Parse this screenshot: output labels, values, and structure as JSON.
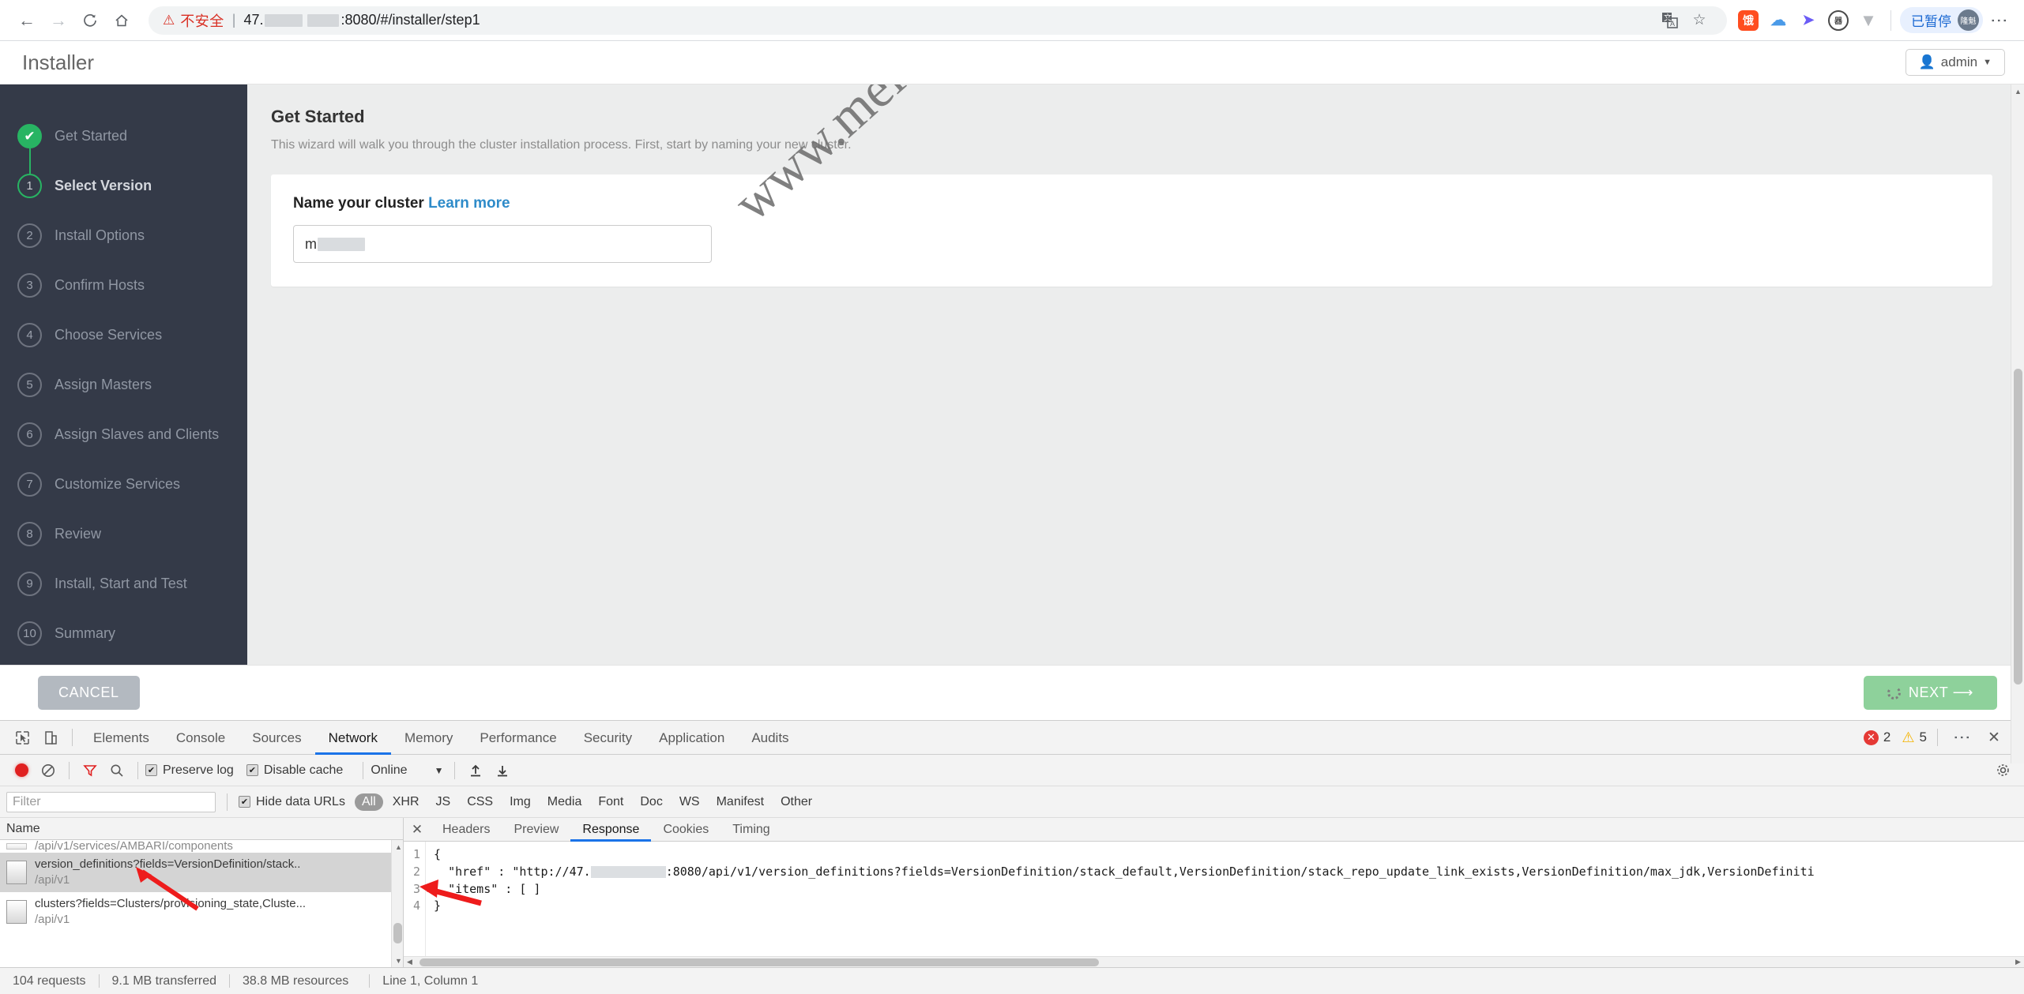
{
  "browser": {
    "nav": {
      "back": "←",
      "forward": "→",
      "reload": "C",
      "home": "⌂"
    },
    "security_warning": "不安全",
    "url_prefix": "47.",
    "url_suffix": ":8080/#/installer/step1",
    "translate_icon": "translate-icon",
    "bookmark_icon": "star-icon",
    "paused_label": "已暂停",
    "avatar_label": "隆魁",
    "menu_icon": "kebab-menu-icon"
  },
  "app": {
    "title": "Installer",
    "admin_label": "admin",
    "sidebar": {
      "steps": [
        {
          "num": "✔",
          "label": "Get Started",
          "state": "done"
        },
        {
          "num": "1",
          "label": "Select Version",
          "state": "active"
        },
        {
          "num": "2",
          "label": "Install Options",
          "state": "pending"
        },
        {
          "num": "3",
          "label": "Confirm Hosts",
          "state": "pending"
        },
        {
          "num": "4",
          "label": "Choose Services",
          "state": "pending"
        },
        {
          "num": "5",
          "label": "Assign Masters",
          "state": "pending"
        },
        {
          "num": "6",
          "label": "Assign Slaves and Clients",
          "state": "pending"
        },
        {
          "num": "7",
          "label": "Customize Services",
          "state": "pending"
        },
        {
          "num": "8",
          "label": "Review",
          "state": "pending"
        },
        {
          "num": "9",
          "label": "Install, Start and Test",
          "state": "pending"
        },
        {
          "num": "10",
          "label": "Summary",
          "state": "pending"
        }
      ]
    },
    "main": {
      "heading": "Get Started",
      "subtext": "This wizard will walk you through the cluster installation process. First, start by naming your new cluster.",
      "card_label": "Name your cluster",
      "learn_more": "Learn more",
      "cluster_name_value": "m",
      "watermark": "www.meilongkui.com"
    },
    "footer": {
      "cancel_label": "CANCEL",
      "next_label": "NEXT ⟶"
    }
  },
  "devtools": {
    "panel_tabs": [
      "Elements",
      "Console",
      "Sources",
      "Network",
      "Memory",
      "Performance",
      "Security",
      "Application",
      "Audits"
    ],
    "selected_panel": "Network",
    "error_count": "2",
    "warning_count": "5",
    "toolbar": {
      "record_icon": "record-icon",
      "clear_icon": "clear-icon",
      "filter_icon": "filter-icon",
      "search_icon": "search-icon",
      "preserve_log": "Preserve log",
      "disable_cache": "Disable cache",
      "throttle_value": "Online",
      "import_icon": "import-har-icon",
      "export_icon": "export-har-icon",
      "settings_icon": "gear-icon"
    },
    "filterbar": {
      "filter_placeholder": "Filter",
      "hide_data_urls": "Hide data URLs",
      "types": [
        "All",
        "XHR",
        "JS",
        "CSS",
        "Img",
        "Media",
        "Font",
        "Doc",
        "WS",
        "Manifest",
        "Other"
      ],
      "selected_type": "All"
    },
    "requests": {
      "column_header": "Name",
      "rows": [
        {
          "name": "/api/v1/services/AMBARI/components",
          "path": "",
          "selected": false,
          "partial": true
        },
        {
          "name": "version_definitions?fields=VersionDefinition/stack..",
          "path": "/api/v1",
          "selected": true,
          "partial": false
        },
        {
          "name": "clusters?fields=Clusters/provisioning_state,Cluste...",
          "path": "/api/v1",
          "selected": false,
          "partial": false
        }
      ]
    },
    "detail_tabs": [
      "Headers",
      "Preview",
      "Response",
      "Cookies",
      "Timing"
    ],
    "selected_detail_tab": "Response",
    "response_code": {
      "line1": "{",
      "line2_a": "\"href\" : \"http://47.",
      "line2_b": ":8080/api/v1/version_definitions?fields=VersionDefinition/stack_default,VersionDefinition/stack_repo_update_link_exists,VersionDefinition/max_jdk,VersionDefiniti",
      "line3": "\"items\" : [ ]",
      "line4": "}",
      "line_numbers": [
        "1",
        "2",
        "3",
        "4"
      ]
    },
    "status": {
      "requests": "104 requests",
      "transferred": "9.1 MB transferred",
      "resources": "38.8 MB resources",
      "cursor": "Line 1, Column 1"
    }
  }
}
